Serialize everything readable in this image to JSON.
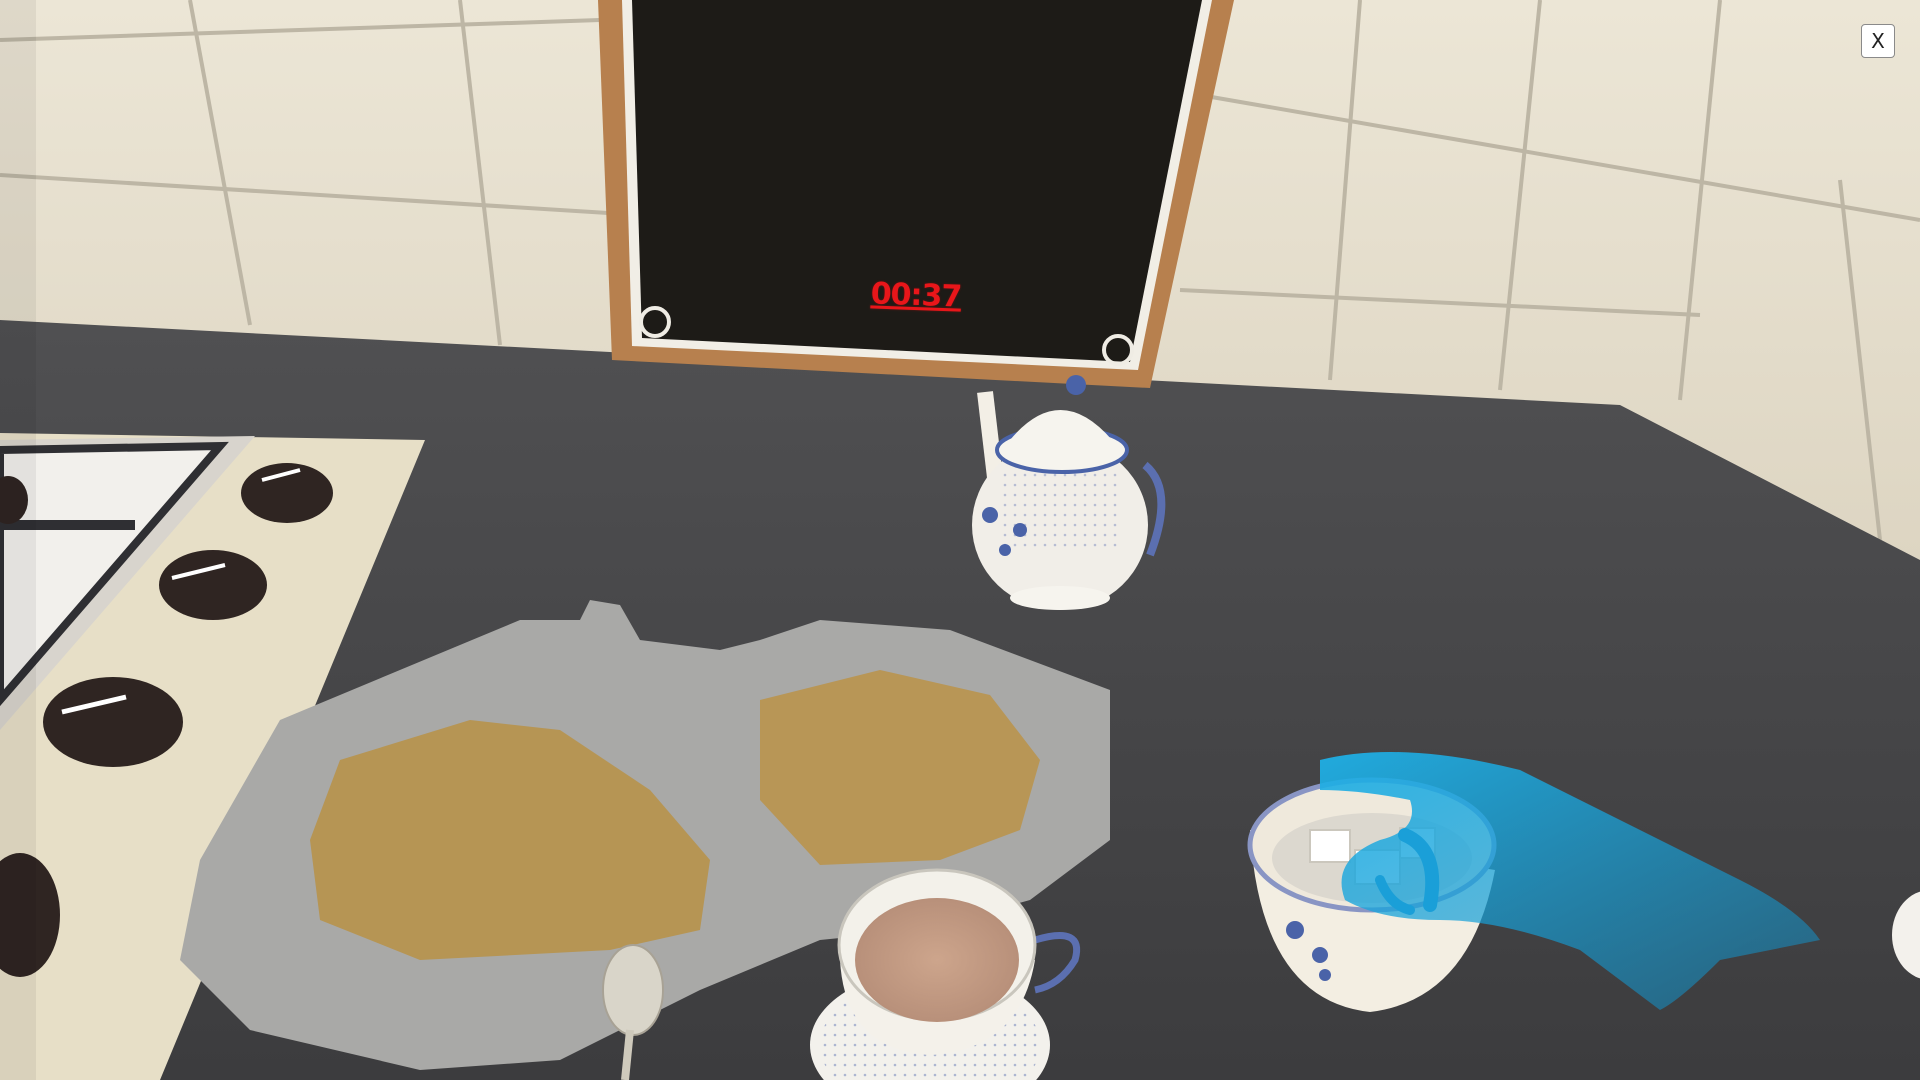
{
  "hud": {
    "timer": "00:37",
    "close_label": "X"
  },
  "scene": {
    "icons": {
      "hand": "virtual-hand-icon",
      "close": "close-icon"
    },
    "colors": {
      "wall_tile": "#e7e0cf",
      "countertop": "#4a4a4c",
      "chalkboard": "#1d1b17",
      "board_frame": "#b7804e",
      "stove": "#e7dfc7",
      "knob": "#2f2522",
      "porcelain_pattern": "#4a63a8",
      "tea": "#c39b83",
      "spill_tea": "#b89656",
      "puddle": "#a8a8a6",
      "hand": "#1a9fd8",
      "timer": "#e8161a"
    }
  }
}
